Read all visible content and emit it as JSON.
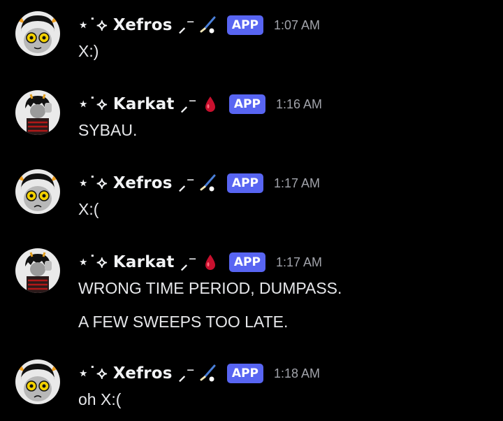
{
  "messages": [
    {
      "author": "⋆˙⟡ Xefros ⸝⁻",
      "author_icon": "hockey-stick-icon",
      "badge": "APP",
      "time": "1:07 AM",
      "lines": [
        "X:)"
      ]
    },
    {
      "author": "⋆˙⟡ Karkat ⸝⁻",
      "author_icon": "blood-drop-icon",
      "badge": "APP",
      "time": "1:16 AM",
      "lines": [
        "SYBAU."
      ]
    },
    {
      "author": "⋆˙⟡ Xefros ⸝⁻",
      "author_icon": "hockey-stick-icon",
      "badge": "APP",
      "time": "1:17 AM",
      "lines": [
        "X:("
      ]
    },
    {
      "author": "⋆˙⟡ Karkat ⸝⁻",
      "author_icon": "blood-drop-icon",
      "badge": "APP",
      "time": "1:17 AM",
      "lines": [
        "WRONG TIME PERIOD, DUMPASS.",
        "A FEW SWEEPS TOO LATE."
      ]
    },
    {
      "author": "⋆˙⟡ Xefros ⸝⁻",
      "author_icon": "hockey-stick-icon",
      "badge": "APP",
      "time": "1:18 AM",
      "lines": [
        "oh X:("
      ]
    }
  ],
  "colors": {
    "background": "#000000",
    "badge": "#5865f2",
    "timestamp": "#a2a4ab",
    "blood": "#c8102e"
  }
}
